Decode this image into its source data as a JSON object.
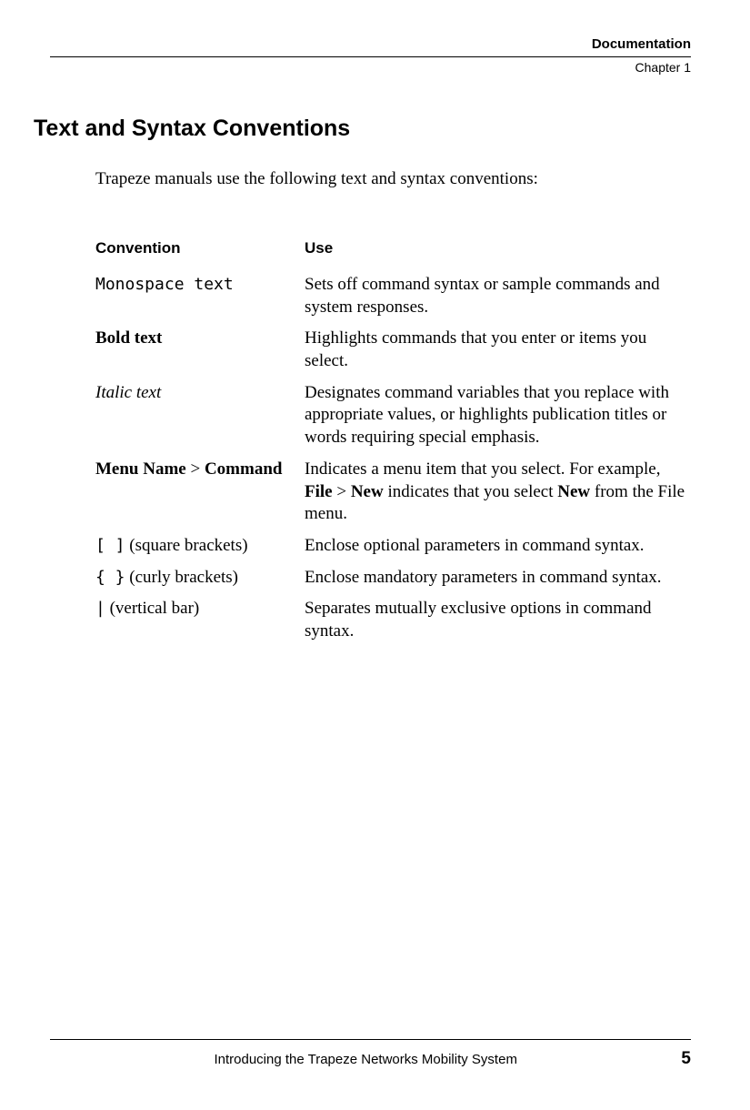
{
  "header": {
    "title": "Documentation",
    "chapter": "Chapter 1"
  },
  "section_heading": "Text and Syntax Conventions",
  "intro": "Trapeze manuals use the following text and syntax conventions:",
  "table": {
    "header_convention": "Convention",
    "header_use": "Use",
    "rows": {
      "r0": {
        "conv_mono": "Monospace text",
        "use": "Sets off command syntax or sample commands and system responses."
      },
      "r1": {
        "conv_bold": "Bold text",
        "use": "Highlights commands that you enter or items you select."
      },
      "r2": {
        "conv_italic": "Italic text",
        "use": "Designates command variables that you replace with appropriate values, or highlights publication titles or words requiring special emphasis."
      },
      "r3": {
        "conv_bold_1": "Menu Name",
        "conv_sep": " > ",
        "conv_bold_2": "Command",
        "use_pre": "Indicates a menu item that you select. For example, ",
        "use_b1": "File",
        "use_mid1": " > ",
        "use_b2": "New",
        "use_mid2": " indicates that you select ",
        "use_b3": "New",
        "use_post": " from the File menu."
      },
      "r4": {
        "conv_mono": "[ ]",
        "conv_rest": " (square brackets)",
        "use": "Enclose optional parameters in command syntax."
      },
      "r5": {
        "conv_mono": "{ }",
        "conv_rest": " (curly brackets)",
        "use": "Enclose mandatory parameters in command syntax."
      },
      "r6": {
        "conv_mono": "|",
        "conv_rest": " (vertical bar)",
        "use": "Separates mutually exclusive options in command syntax."
      }
    }
  },
  "footer": {
    "text": "Introducing the Trapeze Networks Mobility System",
    "page": "5"
  }
}
